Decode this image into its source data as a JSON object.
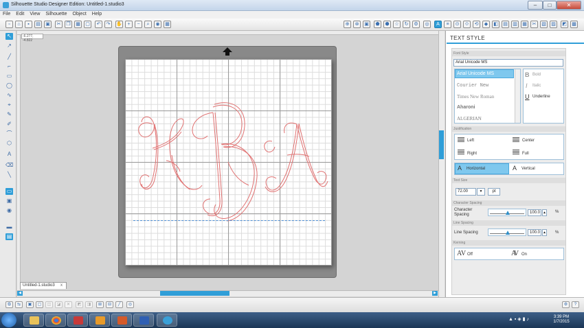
{
  "window": {
    "title": "Silhouette Studio Designer Edition: Untitled-1.studio3",
    "min": "–",
    "max": "□",
    "close": "✕"
  },
  "menu": [
    "File",
    "Edit",
    "View",
    "Silhouette",
    "Object",
    "Help"
  ],
  "canvas": {
    "coords": "-6.277, -4.822",
    "doc_tab": "Untitled-1.studio3",
    "doc_tab_close": "x"
  },
  "panel": {
    "title": "TEXT STYLE",
    "font_style_label": "Font Style",
    "font_value": "Arial Unicode MS",
    "fonts": [
      "Arial Unicode MS",
      "Courier New",
      "Times New Roman",
      "Aharoni",
      "ALGERIAN"
    ],
    "style_options": {
      "bold": "Bold",
      "italic": "Italic",
      "underline": "Underline"
    },
    "justification_label": "Justification",
    "justification": {
      "left": "Left",
      "center": "Center",
      "right": "Right",
      "full": "Full"
    },
    "orientation": {
      "horizontal": "Horizontal",
      "vertical": "Vertical"
    },
    "text_size_label": "Text Size",
    "text_size_value": "72.00",
    "text_size_unit": "pt",
    "character_spacing_section": "Character Spacing",
    "character_spacing_label": "Character Spacing",
    "character_spacing_value": "100.0",
    "character_spacing_unit": "%",
    "line_spacing_section": "Line Spacing",
    "line_spacing_label": "Line Spacing",
    "line_spacing_value": "100.0",
    "line_spacing_unit": "%",
    "kerning_label": "Kerning",
    "kerning": {
      "off": "Off",
      "on": "On"
    }
  },
  "taskbar": {
    "time": "3:39 PM",
    "date": "1/7/2015"
  },
  "colors": {
    "accent": "#2f9ed8",
    "cut_line": "#e07070"
  }
}
